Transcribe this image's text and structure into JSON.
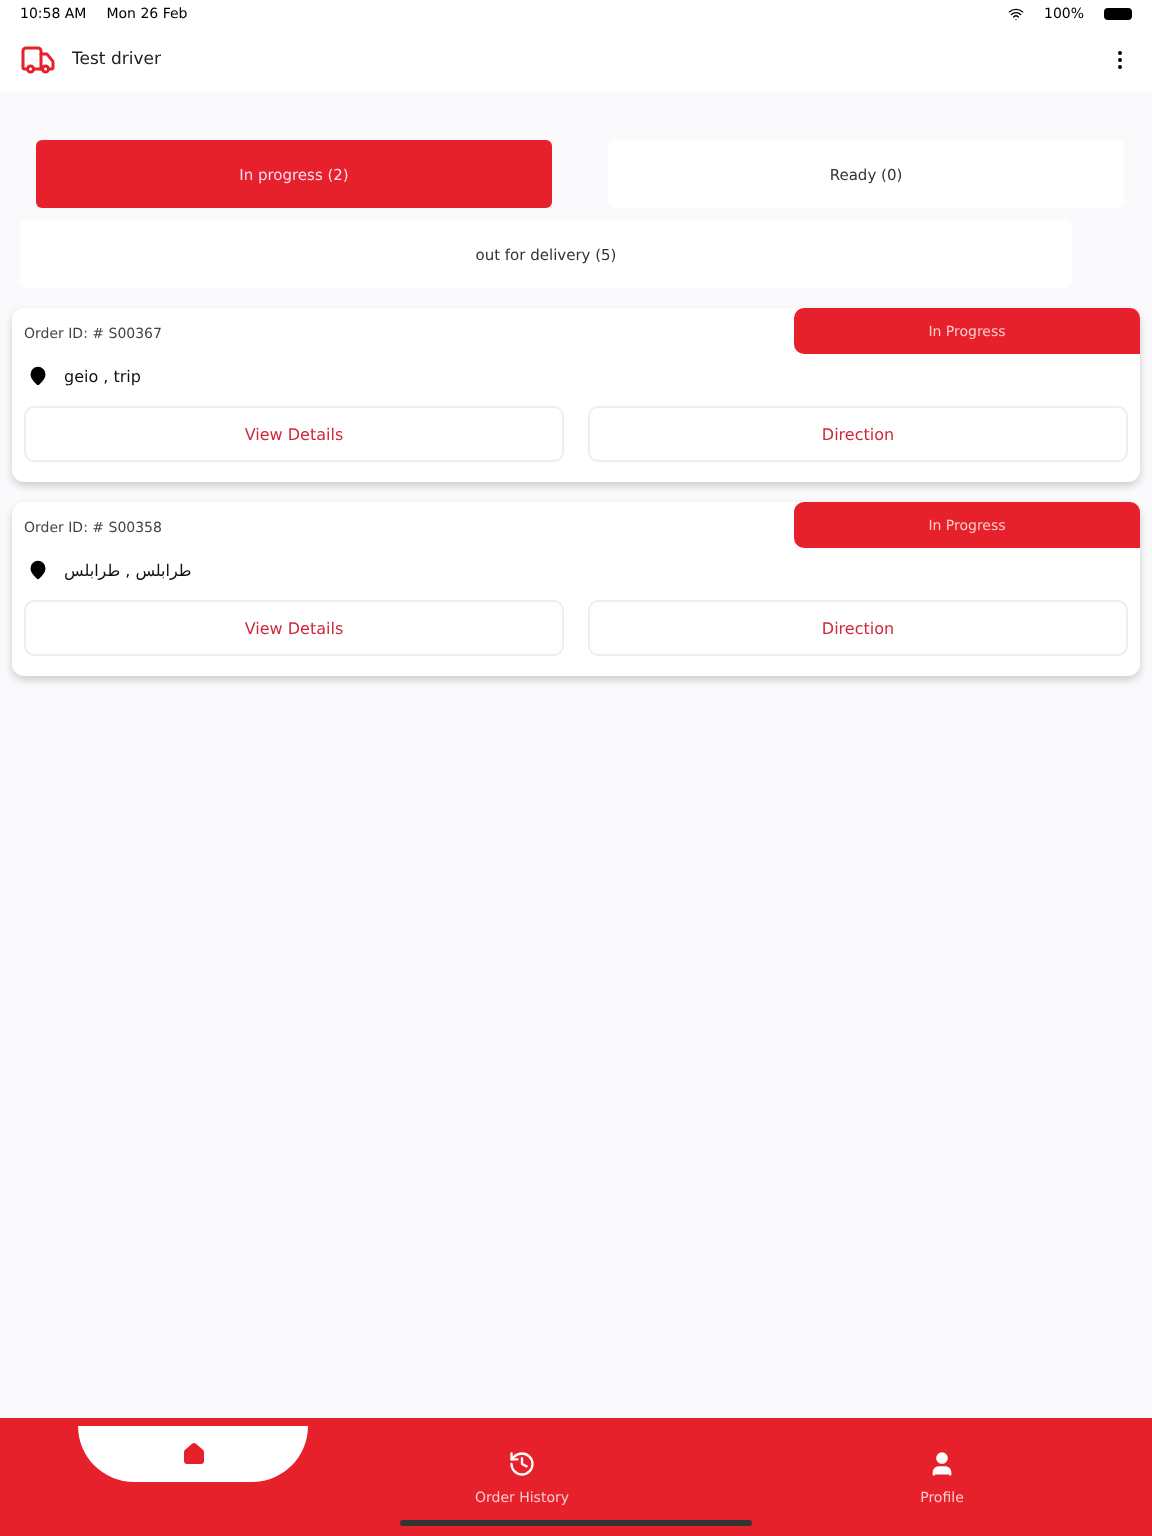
{
  "status_bar": {
    "time": "10:58 AM",
    "date": "Mon 26 Feb",
    "battery": "100%"
  },
  "header": {
    "title": "Test driver"
  },
  "tabs": [
    {
      "label": "In progress (2)",
      "selected": true
    },
    {
      "label": "Ready (0)",
      "selected": false
    },
    {
      "label": "out for delivery (5)",
      "selected": false
    }
  ],
  "orders": [
    {
      "order_id": "Order ID: # S00367",
      "status": "In Progress",
      "address": "geio , trip",
      "buttons": [
        "View Details",
        "Direction"
      ]
    },
    {
      "order_id": "Order ID: # S00358",
      "status": "In Progress",
      "address": "طرابلس , طرابلس",
      "buttons": [
        "View Details",
        "Direction"
      ]
    }
  ],
  "bottom_nav": [
    {
      "kind": "home",
      "selected": true
    },
    {
      "kind": "history",
      "label": "Order History",
      "selected": false
    },
    {
      "kind": "profile",
      "label": "Profile",
      "selected": false
    }
  ]
}
